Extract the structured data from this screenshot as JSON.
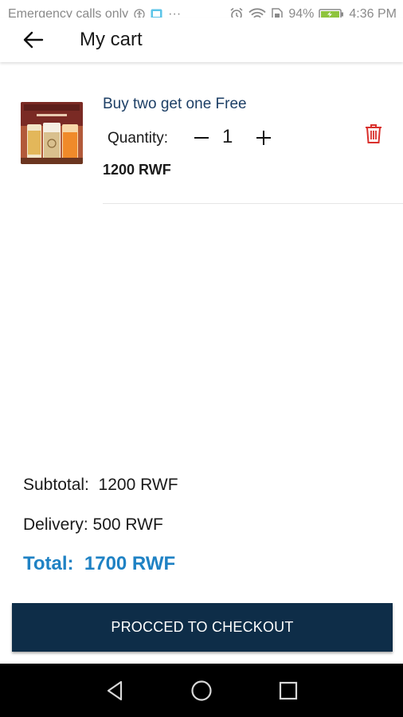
{
  "status_bar": {
    "carrier": "Emergency calls only",
    "more": "···",
    "battery": "94%",
    "time": "4:36 PM",
    "icons": [
      "accessibility-icon",
      "app-notification-icon",
      "alarm-icon",
      "wifi-icon",
      "sim-icon",
      "battery-charging-icon"
    ]
  },
  "header": {
    "back_icon": "arrow-left-icon",
    "title": "My cart"
  },
  "cart": {
    "items": [
      {
        "name": "Buy two get one Free",
        "quantity_label": "Quantity:",
        "quantity": "1",
        "price": "1200 RWF",
        "image_banner": "COME IN TIMES",
        "delete_icon": "trash-icon",
        "minus_icon": "minus-icon",
        "plus_icon": "plus-icon"
      }
    ]
  },
  "summary": {
    "subtotal": "Subtotal:  1200 RWF",
    "delivery": "Delivery: 500 RWF",
    "total": "Total:  1700 RWF"
  },
  "checkout": {
    "label": "PROCCED TO CHECKOUT"
  },
  "nav": {
    "back": "triangle-back-icon",
    "home": "circle-home-icon",
    "recents": "square-recents-icon"
  },
  "colors": {
    "accent": "#1f82c4",
    "button": "#0e2d48",
    "item_name": "#1d3f66",
    "delete": "#d9302c"
  }
}
